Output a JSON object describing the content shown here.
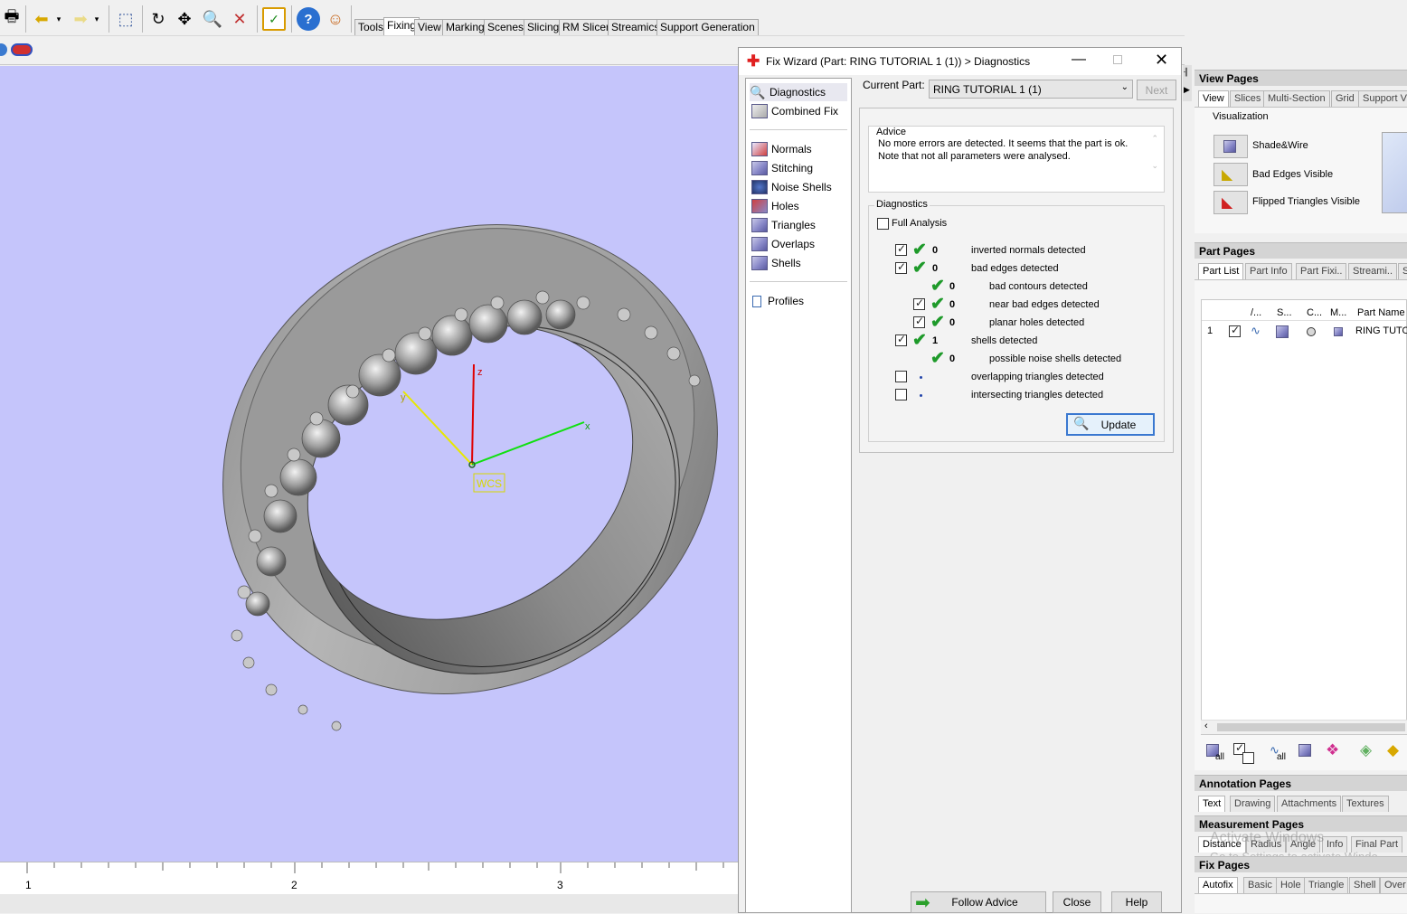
{
  "toolbar": {
    "tabs": [
      "Tools",
      "Fixing",
      "View",
      "Marking",
      "Scenes",
      "Slicing",
      "RM Slicer",
      "Streamics",
      "Support Generation"
    ],
    "active_tab": "Fixing"
  },
  "viewport": {
    "axis_labels": {
      "z": "z",
      "y": "y",
      "x": "x"
    },
    "wcs_label": "WCS",
    "ruler_ticks": [
      "1",
      "2",
      "3"
    ],
    "background": "#c5c5fb"
  },
  "dialog": {
    "title": "Fix Wizard (Part: RING TUTORIAL 1 (1)) > Diagnostics",
    "nav_items": [
      "Diagnostics",
      "Combined Fix",
      "Normals",
      "Stitching",
      "Noise Shells",
      "Holes",
      "Triangles",
      "Overlaps",
      "Shells",
      "Profiles"
    ],
    "current_part_label": "Current Part:",
    "current_part_value": "RING TUTORIAL 1 (1)",
    "next_label": "Next",
    "advice_title": "Advice",
    "advice_line1": "No more errors are detected. It seems that the part is ok.",
    "advice_line2": "Note that not all parameters were analysed.",
    "diagnostics_title": "Diagnostics",
    "full_analysis_label": "Full Analysis",
    "rows": [
      {
        "checked": true,
        "ok": true,
        "count": "0",
        "label": "inverted normals detected"
      },
      {
        "checked": true,
        "ok": true,
        "count": "0",
        "label": "bad edges detected"
      },
      {
        "checked": null,
        "ok": true,
        "count": "0",
        "label": "bad contours detected"
      },
      {
        "checked": true,
        "ok": true,
        "count": "0",
        "label": "near bad edges detected"
      },
      {
        "checked": true,
        "ok": true,
        "count": "0",
        "label": "planar holes detected"
      },
      {
        "checked": true,
        "ok": true,
        "count": "1",
        "label": "shells detected"
      },
      {
        "checked": null,
        "ok": true,
        "count": "0",
        "label": "possible noise shells detected"
      },
      {
        "checked": false,
        "ok": false,
        "count": "",
        "label": "overlapping triangles detected"
      },
      {
        "checked": false,
        "ok": false,
        "count": "",
        "label": "intersecting triangles detected"
      }
    ],
    "update_label": "Update",
    "follow_advice_label": "Follow Advice",
    "close_label": "Close",
    "help_label": "Help"
  },
  "right_panel": {
    "view_pages_title": "View Pages",
    "view_tabs": [
      "View",
      "Slices",
      "Multi-Section",
      "Grid",
      "Support Vi"
    ],
    "visualization_label": "Visualization",
    "vis_items": [
      "Shade&Wire",
      "Bad Edges Visible",
      "Flipped Triangles Visible"
    ],
    "part_pages_title": "Part Pages",
    "part_tabs": [
      "Part List",
      "Part Info",
      "Part Fixi..",
      "Streami..",
      "S"
    ],
    "part_columns": [
      "/...",
      "S...",
      "C...",
      "M...",
      "Part Name"
    ],
    "part_row": {
      "index": "1",
      "name": "RING TUTOR"
    },
    "all_label": "all",
    "annotation_pages_title": "Annotation Pages",
    "annotation_tabs": [
      "Text",
      "Drawing",
      "Attachments",
      "Textures"
    ],
    "measurement_pages_title": "Measurement Pages",
    "measurement_tabs": [
      "Distance",
      "Radius",
      "Angle",
      "Info",
      "Final Part"
    ],
    "watermark_line1": "Activate Windows",
    "watermark_line2": "Go to Settings to activate Windo",
    "fix_pages_title": "Fix Pages",
    "fix_tabs": [
      "Autofix",
      "Basic",
      "Hole",
      "Triangle",
      "Shell",
      "Over"
    ]
  }
}
